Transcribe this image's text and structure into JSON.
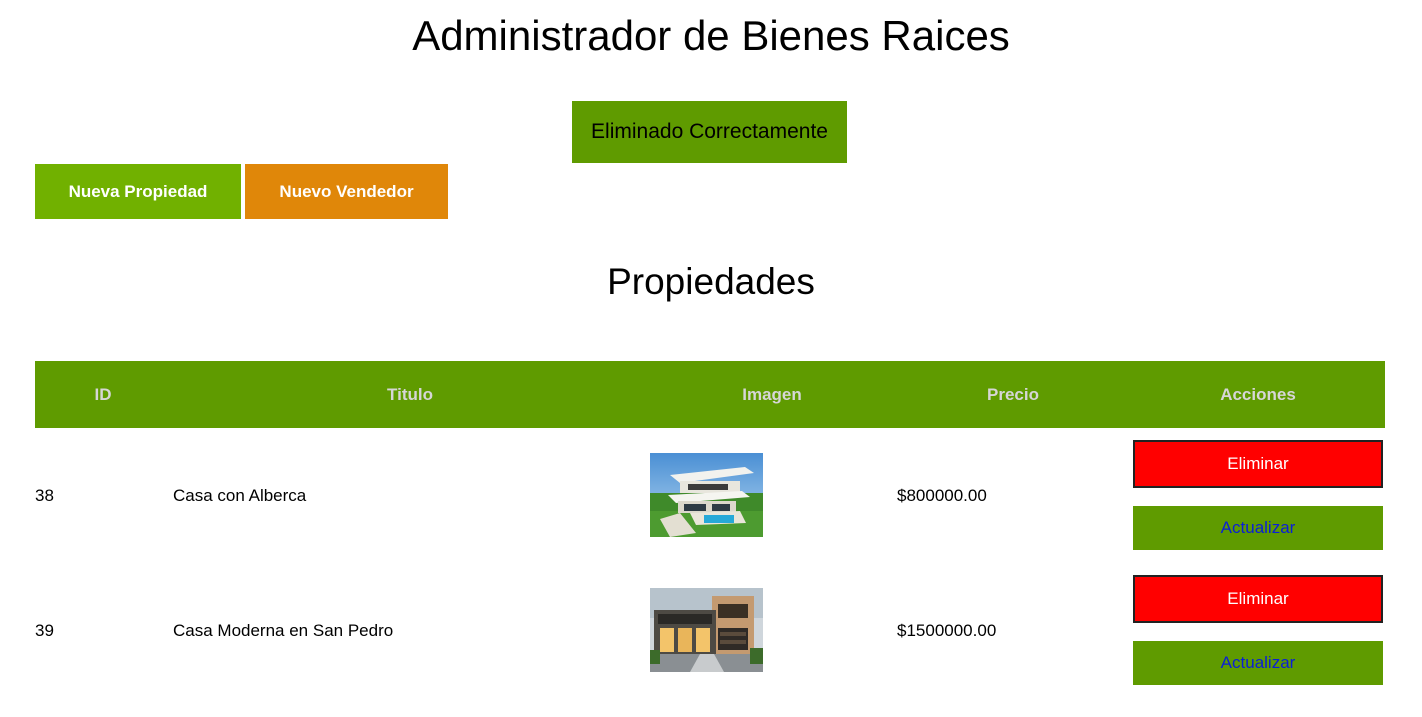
{
  "header": {
    "title": "Administrador de Bienes Raices"
  },
  "alert": {
    "message": "Eliminado Correctamente",
    "color": "#5f9b00"
  },
  "actions": {
    "nueva_propiedad": "Nueva Propiedad",
    "nuevo_vendedor": "Nuevo Vendedor"
  },
  "section": {
    "title": "Propiedades"
  },
  "table": {
    "columns": [
      "ID",
      "Titulo",
      "Imagen",
      "Precio",
      "Acciones"
    ],
    "rows": [
      {
        "id": "38",
        "titulo": "Casa con Alberca",
        "imagen": "modern-house-pool-thumbnail",
        "precio": "$800000.00",
        "eliminar": "Eliminar",
        "actualizar": "Actualizar"
      },
      {
        "id": "39",
        "titulo": "Casa Moderna en San Pedro",
        "imagen": "modern-house-night-thumbnail",
        "precio": "$1500000.00",
        "eliminar": "Eliminar",
        "actualizar": "Actualizar"
      }
    ]
  },
  "colors": {
    "green": "#71b100",
    "dark_green": "#5f9b00",
    "orange": "#e08709",
    "red": "#ff0000"
  }
}
